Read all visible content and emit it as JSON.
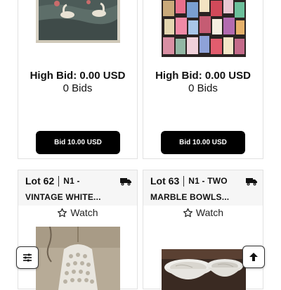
{
  "lots_top": [
    {
      "high_bid": "High Bid: 0.00 USD",
      "bids": "0 Bids",
      "bid_button": "Bid 10.00 USD"
    },
    {
      "high_bid": "High Bid: 0.00 USD",
      "bids": "0 Bids",
      "bid_button": "Bid 10.00 USD"
    }
  ],
  "lots_bottom": [
    {
      "lot_number": "Lot 62",
      "desc_line1": "N1 -",
      "desc_line2": "VINTAGE WHITE...",
      "watch_label": "Watch"
    },
    {
      "lot_number": "Lot 63",
      "desc_line1": "N1 - TWO",
      "desc_line2": "MARBLE BOWLS...",
      "watch_label": "Watch"
    }
  ],
  "controls": {
    "filter_icon": "sliders-icon",
    "scroll_top_icon": "arrow-up-icon"
  },
  "colors": {
    "button_bg": "#000000",
    "header_bg": "#f6f6f6",
    "card_border": "#e2e2e2"
  }
}
